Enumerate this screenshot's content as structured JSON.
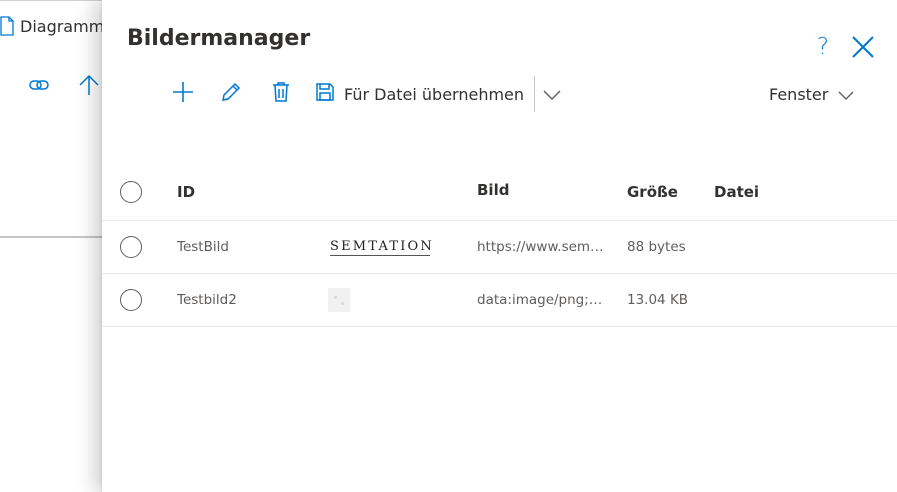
{
  "background": {
    "document_label": "Diagramm"
  },
  "panel": {
    "title": "Bildermanager",
    "help_label": "?",
    "toolbar": {
      "save_label": "Für Datei übernehmen"
    },
    "window_dropdown": {
      "label": "Fenster"
    },
    "table": {
      "columns": [
        "ID",
        "",
        "Bild",
        "Größe",
        "Datei"
      ],
      "rows": [
        {
          "id": "TestBild",
          "thumbnail_text": "SEMTATION",
          "bild": "https://www.sem…",
          "size": "88 bytes",
          "datei": ""
        },
        {
          "id": "Testbild2",
          "thumbnail_text": "",
          "bild": "data:image/png;b…",
          "size": "13.04 KB",
          "datei": ""
        }
      ]
    }
  },
  "colors": {
    "accent": "#0078d4",
    "text": "#323130",
    "muted_text": "#605e5c",
    "divider": "#edebe9"
  },
  "icons": {
    "add": "plus-icon",
    "edit": "pencil-icon",
    "delete": "trash-icon",
    "save": "floppy-disk-icon",
    "close": "close-icon",
    "link": "link-icon",
    "upload": "arrow-up-icon",
    "document": "document-icon"
  }
}
